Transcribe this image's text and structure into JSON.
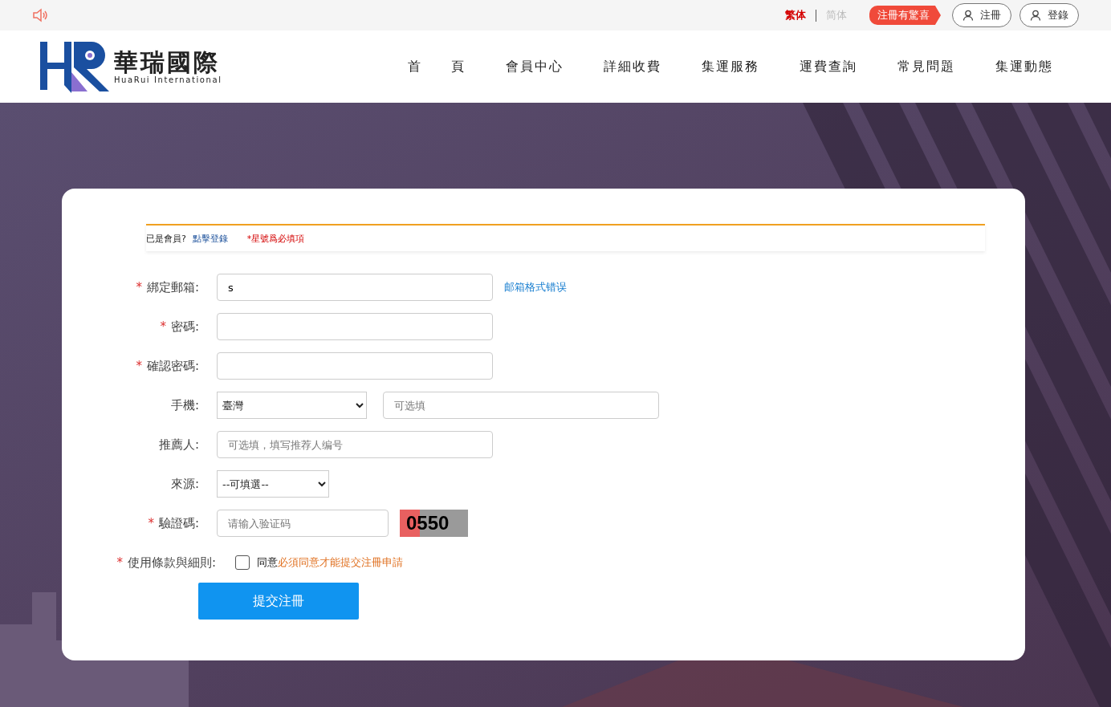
{
  "top_bar": {
    "languages": [
      {
        "label": "繁体",
        "selected": true
      },
      {
        "label": "简体",
        "selected": false
      }
    ],
    "promo": "注冊有驚喜",
    "buttons": [
      "注冊",
      "登錄"
    ]
  },
  "logo": {
    "name": "華瑞國際",
    "subtitle": "HuaRui International"
  },
  "nav": [
    "首　　頁",
    "會員中心",
    "詳細收費",
    "集運服務",
    "運費查詢",
    "常見問題",
    "集運動態"
  ],
  "notice": {
    "text": "已是會員?",
    "link": "點擊登錄",
    "required_note": "*星號爲必填項"
  },
  "fields": [
    {
      "kind": "text",
      "label": "綁定郵箱:",
      "marker": "*",
      "value": "s",
      "message": "邮箱格式错误"
    },
    {
      "kind": "password",
      "label": "密碼:",
      "marker": "*"
    },
    {
      "kind": "password",
      "label": "確認密碼:",
      "marker": "*"
    },
    {
      "kind": "phone",
      "label": "手機:",
      "country": "臺灣",
      "placeholder": "可选填"
    },
    {
      "kind": "text",
      "label": "推薦人:",
      "placeholder": "可选填，填写推荐人编号"
    },
    {
      "kind": "select",
      "label": "來源:",
      "value": "--可填選--"
    },
    {
      "kind": "captcha",
      "label": "驗證碼:",
      "marker": "*",
      "placeholder": "请输入验证码",
      "code": "0550"
    }
  ],
  "terms": {
    "label": "使用條款與細則:",
    "marker": "*",
    "checked": false,
    "agree": "同意",
    "warning": "必須同意才能提交注冊申請"
  },
  "submit": "提交注冊"
}
